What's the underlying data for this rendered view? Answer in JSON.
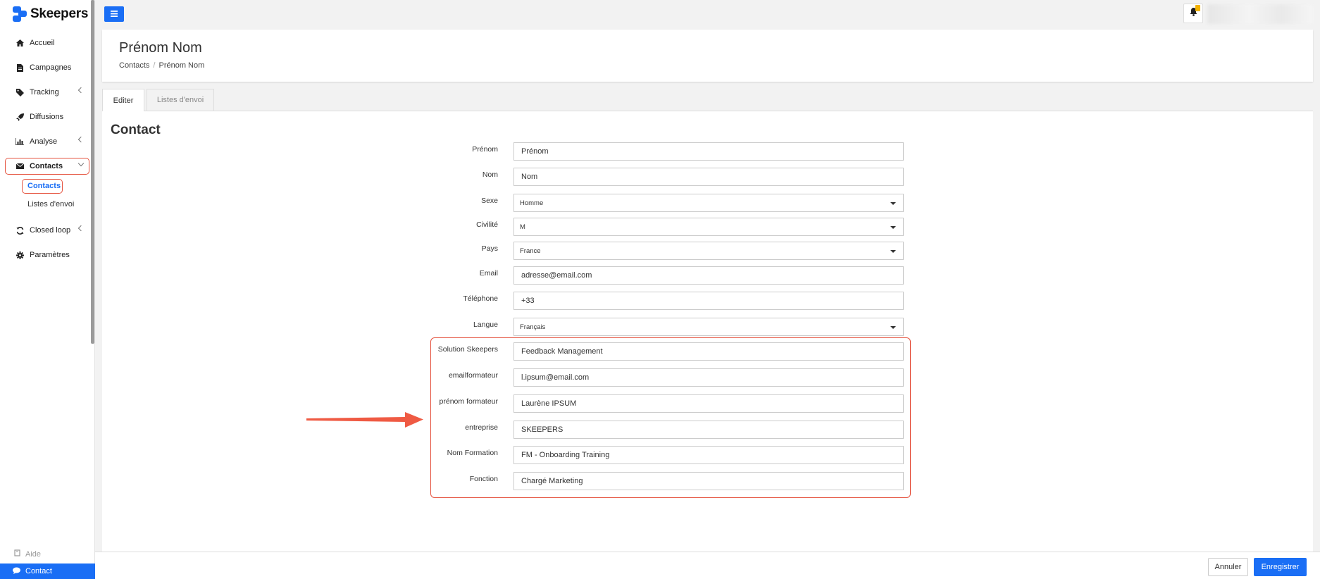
{
  "app": {
    "name": "Skeepers"
  },
  "sidebar": {
    "items": [
      {
        "label": "Accueil",
        "icon": "home-icon"
      },
      {
        "label": "Campagnes",
        "icon": "file-icon"
      },
      {
        "label": "Tracking",
        "icon": "tag-icon"
      },
      {
        "label": "Diffusions",
        "icon": "rocket-icon"
      },
      {
        "label": "Analyse",
        "icon": "bar-chart-icon"
      },
      {
        "label": "Contacts",
        "icon": "envelope-icon"
      },
      {
        "label": "Closed loop",
        "icon": "refresh-icon"
      },
      {
        "label": "Paramètres",
        "icon": "gear-icon"
      }
    ],
    "contacts_sub": [
      {
        "label": "Contacts"
      },
      {
        "label": "Listes d'envoi"
      }
    ],
    "help": "Aide",
    "contact": "Contact"
  },
  "header": {
    "title": "Prénom Nom",
    "breadcrumb": [
      "Contacts",
      "/",
      "Prénom Nom"
    ]
  },
  "tabs": [
    {
      "label": "Editer"
    },
    {
      "label": "Listes d'envoi"
    }
  ],
  "form": {
    "title": "Contact",
    "fields": [
      {
        "label": "Prénom",
        "value": "Prénom"
      },
      {
        "label": "Nom",
        "value": "Nom"
      },
      {
        "label": "Sexe",
        "value": "Homme"
      },
      {
        "label": "Civilité",
        "value": "M"
      },
      {
        "label": "Pays",
        "value": "France"
      },
      {
        "label": "Email",
        "value": "adresse@email.com"
      },
      {
        "label": "Téléphone",
        "value": "+33"
      },
      {
        "label": "Langue",
        "value": "Français"
      },
      {
        "label": "Solution Skeepers",
        "value": "Feedback Management"
      },
      {
        "label": "emailformateur",
        "value": "l.ipsum@email.com"
      },
      {
        "label": "prénom formateur",
        "value": "Laurène IPSUM"
      },
      {
        "label": "entreprise",
        "value": "SKEEPERS"
      },
      {
        "label": "Nom Formation",
        "value": "FM - Onboarding Training"
      },
      {
        "label": "Fonction",
        "value": "Chargé Marketing"
      }
    ]
  },
  "footer": {
    "cancel": "Annuler",
    "save": "Enregistrer"
  },
  "colors": {
    "accent": "#1a6ef5",
    "highlight": "#e5533f"
  }
}
